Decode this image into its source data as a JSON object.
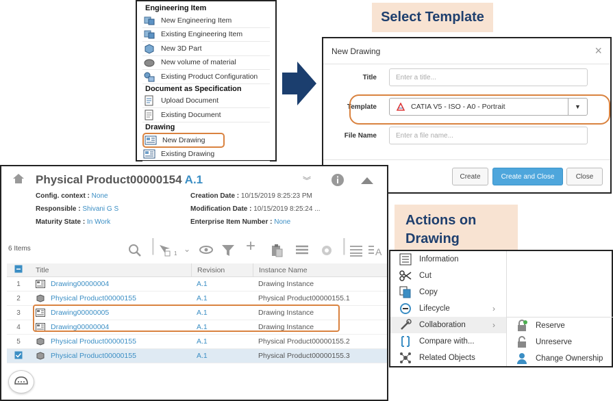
{
  "menu": {
    "sections": [
      {
        "title": "Engineering Item",
        "items": [
          {
            "label": "New Engineering Item",
            "icon": "engineering-item-icon"
          },
          {
            "label": "Existing Engineering Item",
            "icon": "engineering-item-icon"
          },
          {
            "label": "New 3D Part",
            "icon": "3d-part-icon"
          },
          {
            "label": "New volume of material",
            "icon": "volume-material-icon"
          },
          {
            "label": "Existing Product Configuration",
            "icon": "product-config-icon"
          }
        ]
      },
      {
        "title": "Document as Specification",
        "items": [
          {
            "label": "Upload Document",
            "icon": "upload-document-icon"
          },
          {
            "label": "Existing Document",
            "icon": "document-icon"
          }
        ]
      },
      {
        "title": "Drawing",
        "items": [
          {
            "label": "New Drawing",
            "icon": "drawing-icon"
          },
          {
            "label": "Existing Drawing",
            "icon": "drawing-icon"
          }
        ]
      }
    ]
  },
  "labels": {
    "select_template": "Select Template",
    "actions_line1": "Actions on",
    "actions_line2": "Drawing"
  },
  "dialog": {
    "title": "New Drawing",
    "title_label": "Title",
    "title_placeholder": "Enter a title...",
    "template_label": "Template",
    "template_value": "CATIA V5 - ISO - A0 - Portrait",
    "filename_label": "File Name",
    "filename_placeholder": "Enter a file name...",
    "create": "Create",
    "create_close": "Create and Close",
    "close": "Close"
  },
  "panel": {
    "title": "Physical Product00000154",
    "version": "A.1",
    "config_label": "Config. context :",
    "config_value": "None",
    "responsible_label": "Responsible :",
    "responsible_value": "Shivani G S",
    "maturity_label": "Maturity State :",
    "maturity_value": "In Work",
    "creation_label": "Creation Date :",
    "creation_value": "10/15/2019 8:25:23 PM",
    "modification_label": "Modification Date :",
    "modification_value": "10/15/2019 8:25:24 ...",
    "enterprise_label": "Enterprise Item Number :",
    "enterprise_value": "None",
    "item_count": "6 Items",
    "filter_count": "1",
    "columns": {
      "title": "Title",
      "revision": "Revision",
      "instance": "Instance Name"
    },
    "rows": [
      {
        "num": "1",
        "title": "Drawing00000004",
        "rev": "A.1",
        "inst": "Drawing Instance",
        "type": "drawing"
      },
      {
        "num": "2",
        "title": "Physical Product00000155",
        "rev": "A.1",
        "inst": "Physical Product00000155.1",
        "type": "product"
      },
      {
        "num": "3",
        "title": "Drawing00000005",
        "rev": "A.1",
        "inst": "Drawing Instance",
        "type": "drawing"
      },
      {
        "num": "4",
        "title": "Drawing00000004",
        "rev": "A.1",
        "inst": "Drawing Instance",
        "type": "drawing"
      },
      {
        "num": "5",
        "title": "Physical Product00000155",
        "rev": "A.1",
        "inst": "Physical Product00000155.2",
        "type": "product"
      },
      {
        "num": "",
        "title": "Physical Product00000155",
        "rev": "A.1",
        "inst": "Physical Product00000155.3",
        "type": "product",
        "checked": true
      }
    ]
  },
  "context_menu": {
    "items": [
      {
        "label": "Information",
        "icon": "information-icon"
      },
      {
        "label": "Cut",
        "icon": "scissors-icon"
      },
      {
        "label": "Copy",
        "icon": "copy-icon"
      },
      {
        "label": "Lifecycle",
        "icon": "lifecycle-icon",
        "submenu": true
      },
      {
        "label": "Collaboration",
        "icon": "collaboration-icon",
        "submenu": true,
        "active": true
      },
      {
        "label": "Compare with...",
        "icon": "compare-icon"
      },
      {
        "label": "Related Objects",
        "icon": "related-objects-icon"
      }
    ],
    "submenu": [
      {
        "label": "Reserve",
        "icon": "lock-icon"
      },
      {
        "label": "Unreserve",
        "icon": "unlock-icon"
      },
      {
        "label": "Change Ownership",
        "icon": "ownership-icon"
      }
    ]
  },
  "colors": {
    "accent": "#3b8ec4",
    "highlight": "#d9823f",
    "label_bg": "#f8e3d2",
    "label_text": "#1e3f6e",
    "arrow": "#1b3e6e"
  }
}
